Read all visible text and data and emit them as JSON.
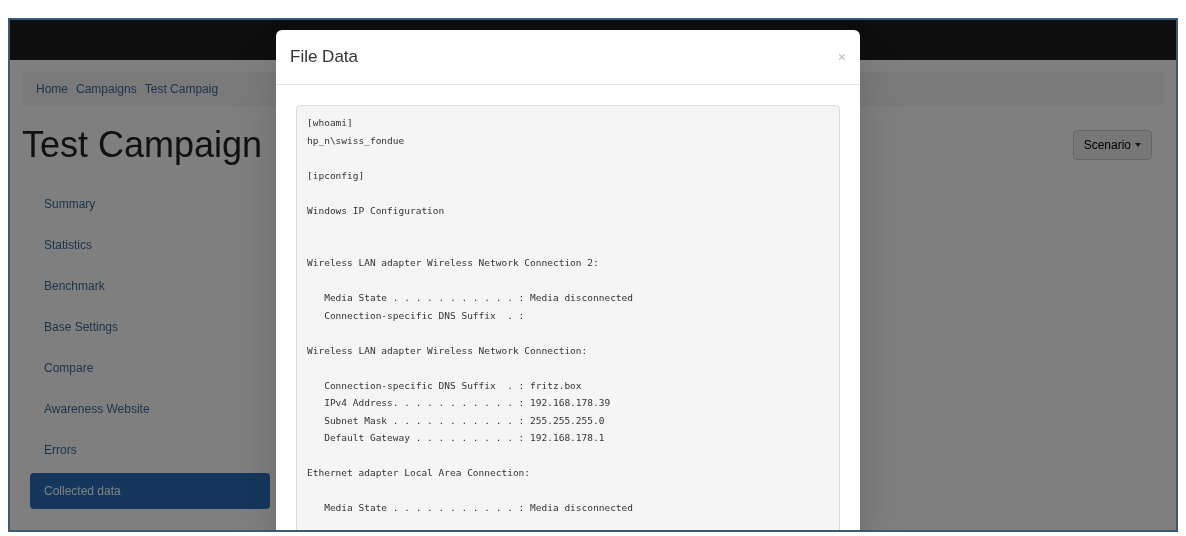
{
  "breadcrumb": [
    {
      "label": "Home"
    },
    {
      "label": "Campaigns"
    },
    {
      "label": "Test Campaig"
    }
  ],
  "page_title": "Test Campaign",
  "scenario_button": {
    "label": "Scenario"
  },
  "sidebar": {
    "items": [
      {
        "label": "Summary",
        "selected": false
      },
      {
        "label": "Statistics",
        "selected": false
      },
      {
        "label": "Benchmark",
        "selected": false
      },
      {
        "label": "Base Settings",
        "selected": false
      },
      {
        "label": "Compare",
        "selected": false
      },
      {
        "label": "Awareness Website",
        "selected": false
      },
      {
        "label": "Errors",
        "selected": false
      },
      {
        "label": "Collected data",
        "selected": true
      }
    ]
  },
  "modal": {
    "title": "File Data",
    "close": "×",
    "file_contents": "[whoami]\nhp_n\\swiss_fondue\n\n[ipconfig]\n\nWindows IP Configuration\n\n\nWireless LAN adapter Wireless Network Connection 2:\n\n   Media State . . . . . . . . . . . : Media disconnected\n   Connection-specific DNS Suffix  . :\n\nWireless LAN adapter Wireless Network Connection:\n\n   Connection-specific DNS Suffix  . : fritz.box\n   IPv4 Address. . . . . . . . . . . : 192.168.178.39\n   Subnet Mask . . . . . . . . . . . : 255.255.255.0\n   Default Gateway . . . . . . . . . : 192.168.178.1\n\nEthernet adapter Local Area Connection:\n\n   Media State . . . . . . . . . . . : Media disconnected"
  }
}
